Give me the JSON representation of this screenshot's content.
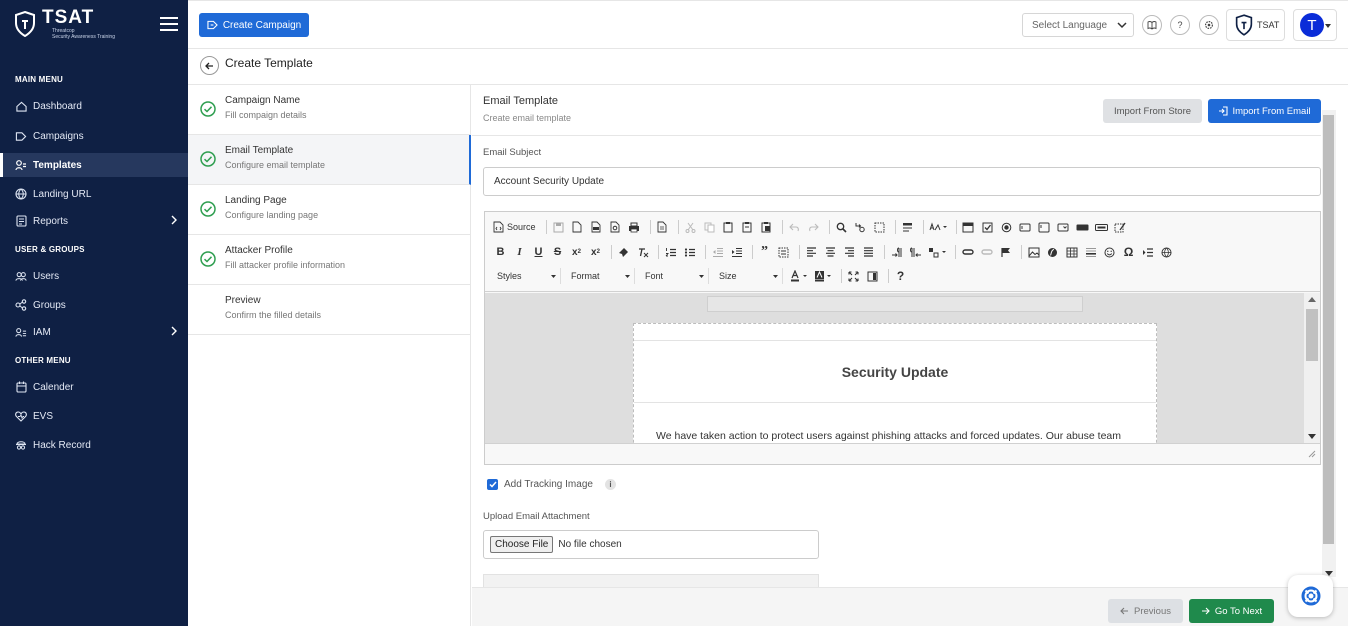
{
  "brand": {
    "name": "TSAT",
    "tagline_line1": "Threatcop",
    "tagline_line2": "Security Awareness Training"
  },
  "sidebar": {
    "sections": [
      {
        "label": "MAIN MENU"
      },
      {
        "label": "USER & GROUPS"
      },
      {
        "label": "OTHER MENU"
      }
    ],
    "items": [
      {
        "label": "Dashboard",
        "icon": "home-icon"
      },
      {
        "label": "Campaigns",
        "icon": "campaign-icon"
      },
      {
        "label": "Templates",
        "icon": "template-icon",
        "active": true
      },
      {
        "label": "Landing URL",
        "icon": "globe-icon"
      },
      {
        "label": "Reports",
        "icon": "report-icon",
        "has_submenu": true
      },
      {
        "label": "Users",
        "icon": "users-icon"
      },
      {
        "label": "Groups",
        "icon": "groups-icon"
      },
      {
        "label": "IAM",
        "icon": "iam-icon",
        "has_submenu": true
      },
      {
        "label": "Calender",
        "icon": "calendar-icon"
      },
      {
        "label": "EVS",
        "icon": "heart-icon"
      },
      {
        "label": "Hack Record",
        "icon": "hacker-icon"
      }
    ]
  },
  "topbar": {
    "create_campaign": "Create Campaign",
    "language_placeholder": "Select Language",
    "help_label": "?",
    "brand_label": "TSAT",
    "avatar_initial": "T"
  },
  "page": {
    "title": "Create Template"
  },
  "steps": [
    {
      "title": "Campaign Name",
      "subtitle": "Fill compaign details",
      "done": true
    },
    {
      "title": "Email Template",
      "subtitle": "Configure email template",
      "done": true,
      "active": true
    },
    {
      "title": "Landing Page",
      "subtitle": "Configure landing page",
      "done": true
    },
    {
      "title": "Attacker Profile",
      "subtitle": "Fill attacker profile information",
      "done": true
    },
    {
      "title": "Preview",
      "subtitle": "Confirm the filled details",
      "done": false
    }
  ],
  "panel": {
    "title": "Email Template",
    "subtitle": "Create email template",
    "import_store": "Import From Store",
    "import_email": "Import From Email",
    "subject_label": "Email Subject",
    "subject_value": "Account Security Update",
    "editor": {
      "source_label": "Source",
      "combos": [
        "Styles",
        "Format",
        "Font",
        "Size"
      ],
      "email_heading": "Security Update",
      "email_body": "We have taken action to protect users against phishing attacks and forced updates. Our abuse team"
    },
    "tracking_label": "Add Tracking Image",
    "tracking_checked": true,
    "info_label": "i",
    "attachment_label": "Upload Email Attachment",
    "choose_file": "Choose File",
    "no_file": "No file chosen"
  },
  "footer": {
    "previous": "Previous",
    "next": "Go To Next"
  },
  "colors": {
    "sidebar_bg": "#0f2044",
    "accent": "#1f6ad7",
    "success": "#1f8a4c",
    "step_check": "#2e9e4f"
  }
}
